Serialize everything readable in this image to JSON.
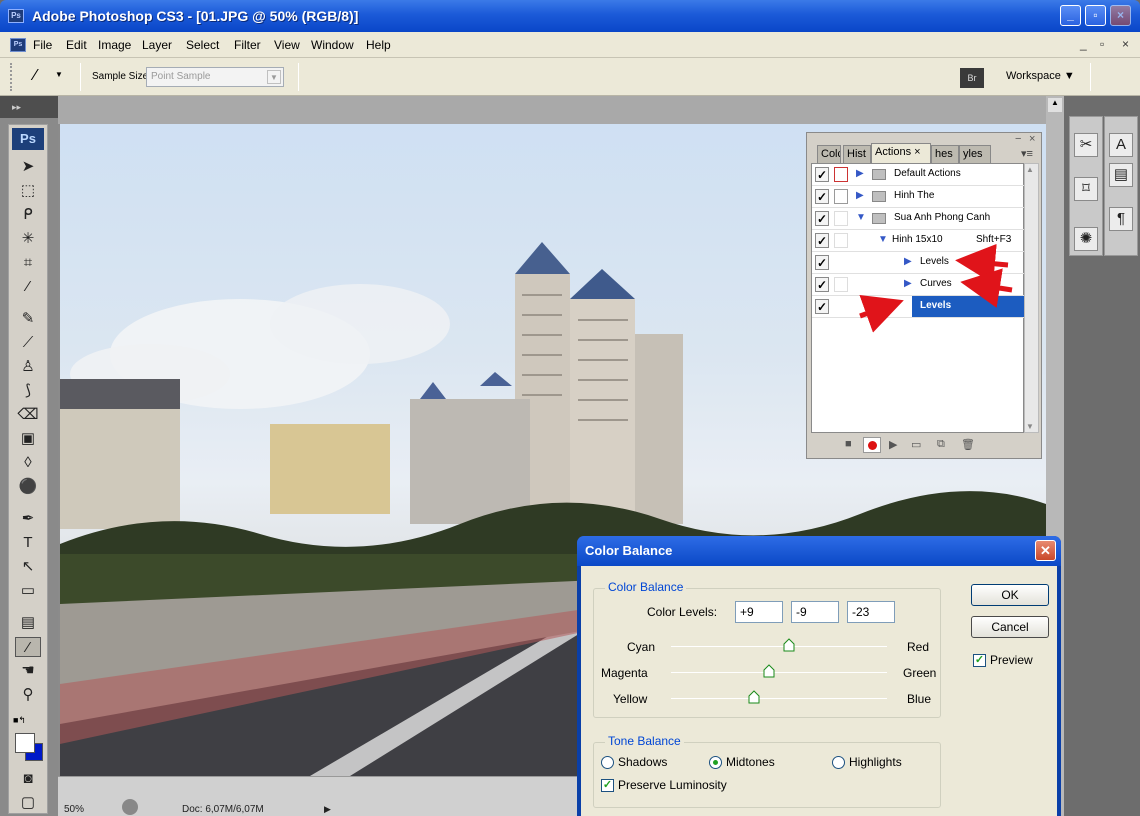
{
  "window": {
    "app_icon": "Ps",
    "title": "Adobe Photoshop CS3 - [01.JPG @ 50% (RGB/8)]",
    "controls": [
      "_",
      "▫",
      "×"
    ]
  },
  "menubar": {
    "doc_icon": "Ps",
    "items": [
      "File",
      "Edit",
      "Image",
      "Layer",
      "Select",
      "Filter",
      "View",
      "Window",
      "Help"
    ],
    "doc_controls": [
      "_",
      "▫",
      "×"
    ]
  },
  "options": {
    "tool_icon": "eyedropper-icon",
    "sample_size_label": "Sample Size:",
    "sample_size_value": "Point Sample",
    "bridge_icon": "Br",
    "workspace_label": "Workspace ▼"
  },
  "toolbox": {
    "badge": "Ps",
    "collapse": "▸▸"
  },
  "status": {
    "zoom": "50%",
    "doc": "Doc: 6,07M/6,07M"
  },
  "actions_panel": {
    "tabs": [
      "Colc",
      "Hist",
      "Actions ×",
      "hes",
      "yles"
    ],
    "rows": [
      {
        "check": "✓",
        "type": "set",
        "label": "Default Actions"
      },
      {
        "check": "✓",
        "type": "set",
        "label": "Hinh The"
      },
      {
        "check": "✓",
        "type": "set",
        "label": "Sua Anh Phong Canh"
      },
      {
        "check": "✓",
        "type": "action",
        "label": "Hinh 15x10",
        "shortcut": "Shft+F3"
      },
      {
        "check": "✓",
        "type": "step",
        "label": "Levels"
      },
      {
        "check": "✓",
        "type": "step",
        "label": "Curves"
      },
      {
        "check": "✓",
        "type": "step",
        "label": "Levels"
      }
    ]
  },
  "color_balance": {
    "title": "Color Balance",
    "close": "✕",
    "group_label": "Color Balance",
    "levels_label": "Color Levels:",
    "levels": [
      "+9",
      "-9",
      "-23"
    ],
    "sliders": [
      {
        "left": "Cyan",
        "right": "Red",
        "value": 9
      },
      {
        "left": "Magenta",
        "right": "Green",
        "value": -9
      },
      {
        "left": "Yellow",
        "right": "Blue",
        "value": -23
      }
    ],
    "tone_label": "Tone Balance",
    "tones": [
      "Shadows",
      "Midtones",
      "Highlights"
    ],
    "selected_tone": "Midtones",
    "preserve_label": "Preserve Luminosity",
    "preserve_checked": true,
    "ok": "OK",
    "cancel": "Cancel",
    "preview_label": "Preview",
    "preview_checked": true
  }
}
